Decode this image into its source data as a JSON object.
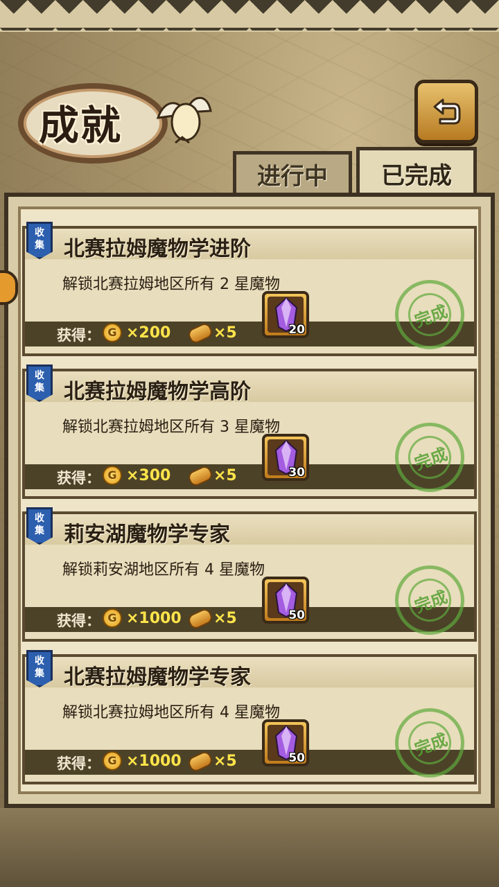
{
  "header": {
    "title": "成就",
    "back_icon": "back-arrow-icon"
  },
  "tabs": [
    {
      "label": "进行中",
      "active": false
    },
    {
      "label": "已完成",
      "active": true
    }
  ],
  "reward_label": "获得：",
  "cards": [
    {
      "tag": "收\n集",
      "title": "北赛拉姆魔物学进阶",
      "desc": "解锁北赛拉姆地区所有 2 星魔物",
      "coins": "×200",
      "bread": "×5",
      "gems": "20",
      "stamp": "完成"
    },
    {
      "tag": "收\n集",
      "title": "北赛拉姆魔物学高阶",
      "desc": "解锁北赛拉姆地区所有 3 星魔物",
      "coins": "×300",
      "bread": "×5",
      "gems": "30",
      "stamp": "完成"
    },
    {
      "tag": "收\n集",
      "title": "莉安湖魔物学专家",
      "desc": "解锁莉安湖地区所有 4 星魔物",
      "coins": "×1000",
      "bread": "×5",
      "gems": "50",
      "stamp": "完成"
    },
    {
      "tag": "收\n集",
      "title": "北赛拉姆魔物学专家",
      "desc": "解锁北赛拉姆地区所有 4 星魔物",
      "coins": "×1000",
      "bread": "×5",
      "gems": "50",
      "stamp": "完成"
    }
  ],
  "colors": {
    "gold": "#ffe44a",
    "stamp_green": "#5aa032",
    "tag_blue": "#2c5fae"
  }
}
